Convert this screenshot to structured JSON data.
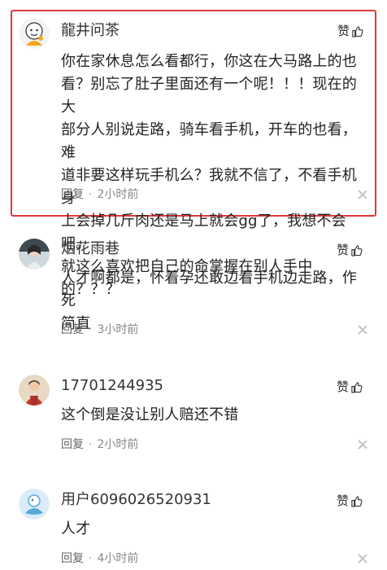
{
  "comments": [
    {
      "username": "龍井问茶",
      "like_label": "赞",
      "text_lines": [
        "你在家休息怎么看都行，你这在大马路上的也",
        "看？别忘了肚子里面还有一个呢！！！现在的大",
        "部分人别说走路，骑车看手机，开车的也看，难",
        "道非要这样玩手机么？我就不信了，不看手机身",
        "上会掉几斤肉还是马上就会gg了，我想不会吧。",
        "就这么喜欢把自己的命掌握在别人手中的？？？"
      ],
      "reply_label": "回复",
      "time": "2小时前",
      "avatar_icon": "cartoon-avatar-icon"
    },
    {
      "username": "烟花雨巷",
      "like_label": "赞",
      "text_lines": [
        "人才啊都是，怀着孕还敢边看手机边走路，作死",
        "简直"
      ],
      "reply_label": "回复",
      "time": "3小时前",
      "avatar_icon": "photo-avatar-icon"
    },
    {
      "username": "17701244935",
      "like_label": "赞",
      "text_lines": [
        "这个倒是没让别人赔还不错"
      ],
      "reply_label": "回复",
      "time": "2小时前",
      "avatar_icon": "photo-avatar-icon"
    },
    {
      "username": "用户6096026520931",
      "like_label": "赞",
      "text_lines": [
        "人才"
      ],
      "reply_label": "回复",
      "time": "4小时前",
      "avatar_icon": "default-avatar-icon"
    }
  ],
  "colors": {
    "highlight_border": "#e03a3a",
    "meta_text": "#888888"
  }
}
